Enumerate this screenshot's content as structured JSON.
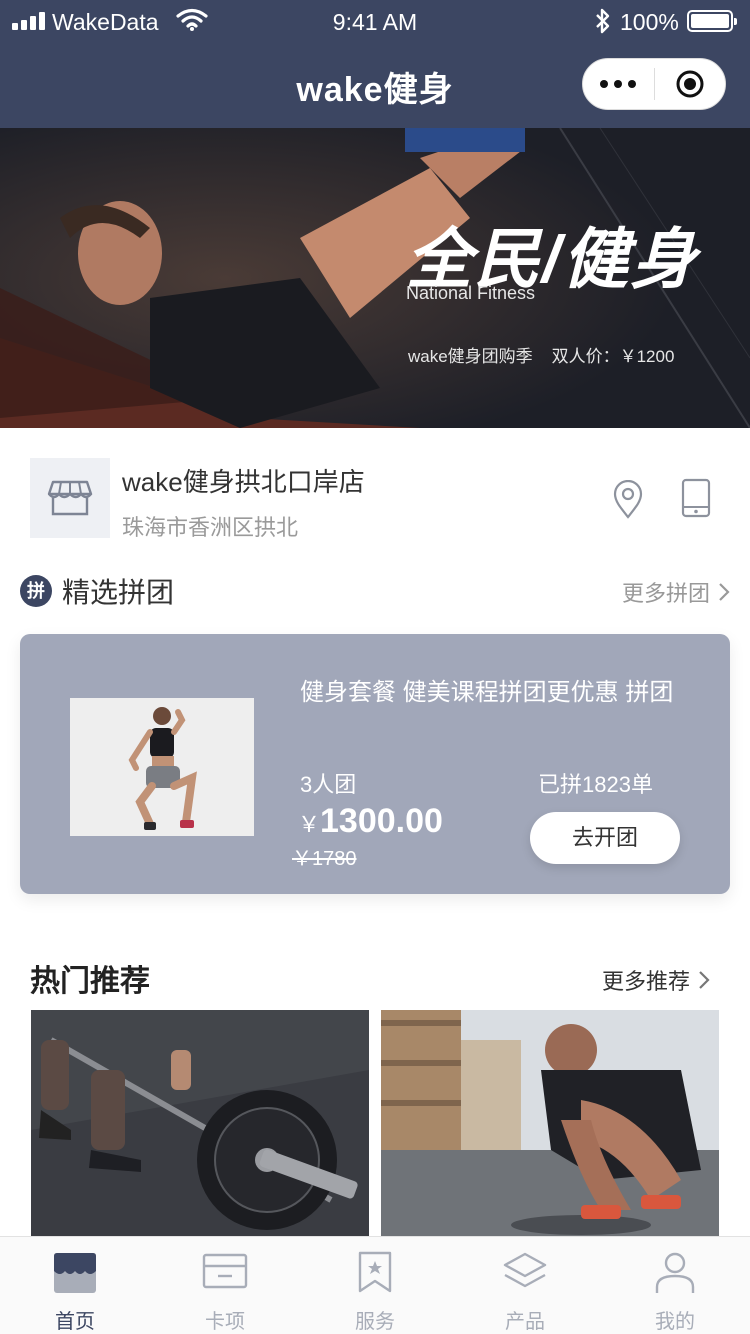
{
  "status_bar": {
    "carrier": "WakeData",
    "time": "9:41 AM",
    "battery_percent": "100%",
    "battery_level": 1.0
  },
  "nav": {
    "title": "wake健身"
  },
  "banner": {
    "title": "全民/健身",
    "subtitle": "National Fitness",
    "promo": "wake健身团购季    双人价：￥1200"
  },
  "store": {
    "name": "wake健身拱北口岸店",
    "address": "珠海市香洲区拱北"
  },
  "group_section": {
    "badge": "拼",
    "title": "精选拼团",
    "more": "更多拼团"
  },
  "deal": {
    "title": "健身套餐 健美课程拼团更优惠 拼团",
    "size": "3人团",
    "sold": "已拼1823单",
    "currency": "￥",
    "price": "1300.00",
    "original_price": "￥1780",
    "button": "去开团"
  },
  "recommend_section": {
    "title": "热门推荐",
    "more": "更多推荐"
  },
  "tabbar": {
    "items": [
      {
        "label": "首页",
        "icon": "home-icon"
      },
      {
        "label": "卡项",
        "icon": "card-icon"
      },
      {
        "label": "服务",
        "icon": "bookmark-icon"
      },
      {
        "label": "产品",
        "icon": "layers-icon"
      },
      {
        "label": "我的",
        "icon": "user-icon"
      }
    ]
  },
  "colors": {
    "nav_bg": "#3c4662",
    "deal_bg": "#a1a7b9",
    "muted": "#9a9a9a",
    "tab_inactive": "#a8adb8"
  }
}
